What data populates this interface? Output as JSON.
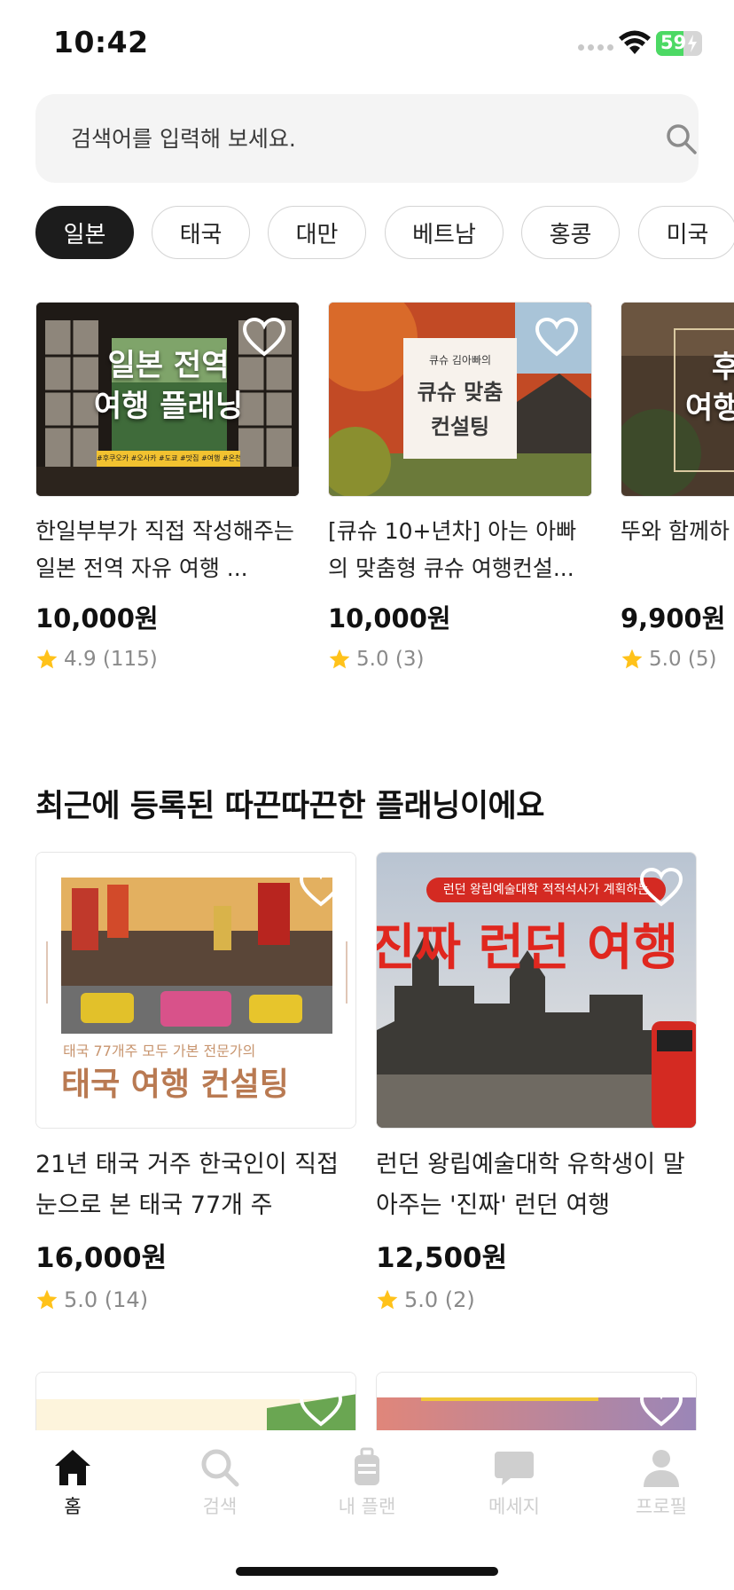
{
  "status_bar": {
    "time": "10:42",
    "battery": "59",
    "battery_level": 0.59
  },
  "search": {
    "placeholder": "검색어를 입력해 보세요."
  },
  "categories": [
    {
      "label": "일본",
      "active": true
    },
    {
      "label": "태국",
      "active": false
    },
    {
      "label": "대만",
      "active": false
    },
    {
      "label": "베트남",
      "active": false
    },
    {
      "label": "홍콩",
      "active": false
    },
    {
      "label": "미국",
      "active": false
    }
  ],
  "featured": [
    {
      "thumb_text": [
        "일본 전역",
        "여행 플래닝"
      ],
      "thumb_tags": "#후쿠오카 #오사카 #도쿄 #맛집 #여행 #온천",
      "title": "한일부부가 직접 작성해주는 일본 전역 자유 여행 ...",
      "price": "10,000원",
      "rating": "4.9 (115)"
    },
    {
      "thumb_text": [
        "큐슈 김아빠의",
        "큐슈 맞춤",
        "컨설팅"
      ],
      "title": "[큐슈 10+년차] 아는 아빠의 맞춤형 큐슈 여행컨설...",
      "price": "10,000원",
      "rating": "5.0 (3)"
    },
    {
      "thumb_text": [
        "후",
        "여행"
      ],
      "title": "뚜와 함께하 유여행 계획",
      "price": "9,900원",
      "rating": "5.0 (5)"
    }
  ],
  "recent_section": {
    "title": "최근에 등록된 따끈따끈한 플래닝이에요",
    "items": [
      {
        "thumb_sub": "태국 77개주 모두 가본 전문가의",
        "thumb_main": "태국 여행 컨설팅",
        "title": "21년 태국 거주 한국인이 직접 눈으로 본 태국 77개 주",
        "price": "16,000원",
        "rating": "5.0 (14)"
      },
      {
        "thumb_banner": "런던 왕립예술대학 적적석사가 계획하는",
        "thumb_main": "진짜 런던 여행",
        "title": "런던 왕립예술대학 유학생이 말아주는 '진짜' 런던 여행",
        "price": "12,500원",
        "rating": "5.0 (2)"
      }
    ]
  },
  "tabbar": [
    {
      "label": "홈",
      "icon": "home-icon",
      "active": true
    },
    {
      "label": "검색",
      "icon": "search-icon",
      "active": false
    },
    {
      "label": "내 플랜",
      "icon": "luggage-icon",
      "active": false
    },
    {
      "label": "메세지",
      "icon": "message-icon",
      "active": false
    },
    {
      "label": "프로필",
      "icon": "profile-icon",
      "active": false
    }
  ]
}
